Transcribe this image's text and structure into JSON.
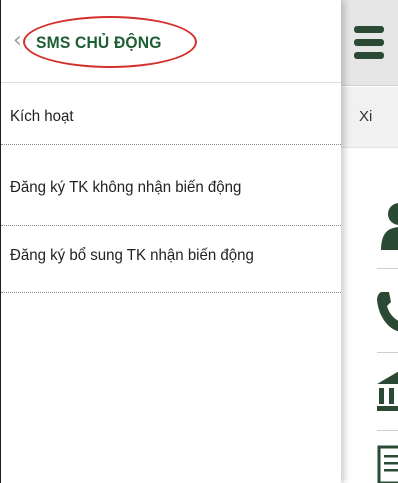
{
  "drawer": {
    "title": "SMS CHỦ ĐỘNG",
    "back_icon": "chevron-left-icon",
    "items": [
      {
        "label": "Kích hoạt"
      },
      {
        "label": "Đăng ký TK không nhận biến động"
      },
      {
        "label": "Đăng ký bổ sung TK nhận biến động"
      }
    ]
  },
  "background_app": {
    "menu_icon": "hamburger-icon",
    "subbar_text": "Xi",
    "icons": [
      "user-icon",
      "phone-icon",
      "bank-icon",
      "document-icon"
    ]
  },
  "colors": {
    "title_green": "#1d5e33",
    "highlight_red": "#d4302b",
    "icon_dark_green": "#2b4a34"
  }
}
